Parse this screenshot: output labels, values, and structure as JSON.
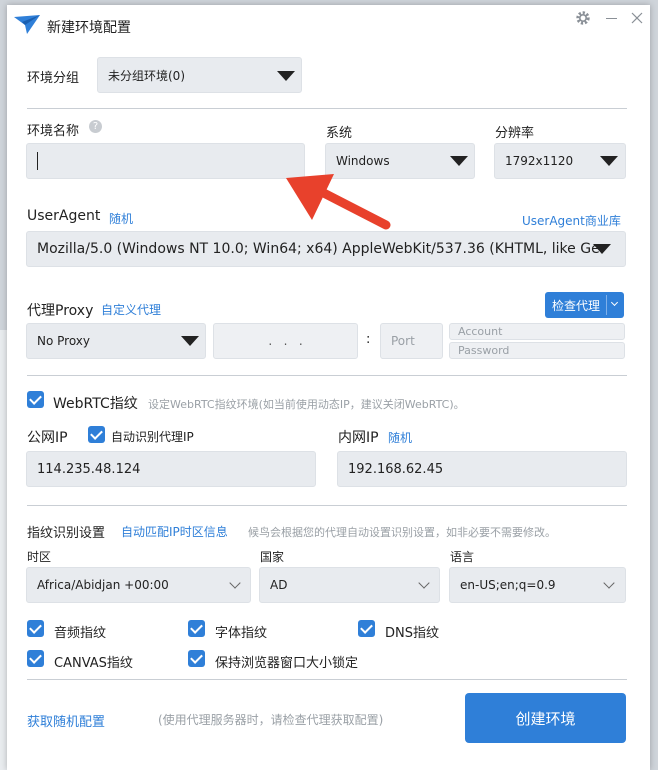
{
  "window": {
    "title": "新建环境配置"
  },
  "group": {
    "label": "环境分组",
    "value": "未分组环境(0)"
  },
  "env_name": {
    "label": "环境名称",
    "value": ""
  },
  "system": {
    "label": "系统",
    "value": "Windows"
  },
  "resolution": {
    "label": "分辨率",
    "value": "1792x1120"
  },
  "useragent": {
    "label": "UserAgent",
    "random_link": "随机",
    "library_link": "UserAgent商业库",
    "value": "Mozilla/5.0 (Windows NT 10.0; Win64; x64) AppleWebKit/537.36 (KHTML, like Ge"
  },
  "proxy": {
    "label": "代理Proxy",
    "custom_link": "自定义代理",
    "check_button": "检查代理",
    "type_value": "No Proxy",
    "ip_placeholder": ".   .   .",
    "colon": ":",
    "port_placeholder": "Port",
    "account_placeholder": "Account",
    "password_placeholder": "Password"
  },
  "webrtc": {
    "label": "WebRTC指纹",
    "hint": "设定WebRTC指纹环境(如当前使用动态IP，建议关闭WebRTC)。",
    "checked": true
  },
  "public_ip": {
    "label": "公网IP",
    "auto_label": "自动识别代理IP",
    "value": "114.235.48.124"
  },
  "private_ip": {
    "label": "内网IP",
    "random_link": "随机",
    "value": "192.168.62.45"
  },
  "fingerprint": {
    "label": "指纹识别设置",
    "auto_link": "自动匹配IP时区信息",
    "hint": "候鸟会根据您的代理自动设置识别设置，如非必要不需要修改。",
    "timezone_label": "时区",
    "timezone_value": "Africa/Abidjan +00:00",
    "country_label": "国家",
    "country_value": "AD",
    "language_label": "语言",
    "language_value": "en-US;en;q=0.9"
  },
  "options": [
    {
      "label": "音频指纹",
      "checked": true
    },
    {
      "label": "字体指纹",
      "checked": true
    },
    {
      "label": "DNS指纹",
      "checked": true
    },
    {
      "label": "CANVAS指纹",
      "checked": true
    },
    {
      "label": "保持浏览器窗口大小锁定",
      "checked": true
    }
  ],
  "footer": {
    "random_config_link": "获取随机配置",
    "note": "(使用代理服务器时，请检查代理获取配置)",
    "create_button": "创建环境"
  },
  "colors": {
    "accent": "#2f7fd8",
    "arrow": "#e8412c",
    "field_bg": "#e8ebef"
  },
  "icons": [
    "app-logo-icon",
    "settings-gear-icon",
    "minimize-icon",
    "close-icon",
    "help-icon",
    "red-arrow-annotation"
  ]
}
